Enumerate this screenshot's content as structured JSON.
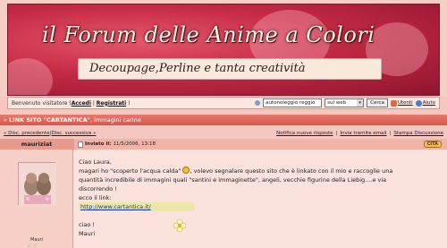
{
  "banner": {
    "title": "il Forum delle Anime a Colori",
    "subtitle": "Decoupage,Perline e tanta creatività"
  },
  "toolbar": {
    "welcome_prefix": "Benvenuto visitatore (",
    "login_label": "Accedi",
    "separator": " | ",
    "register_label": "Registrati",
    "welcome_suffix": " )",
    "search_value": "autonoleggio reggio",
    "search_scope": "sul web",
    "search_button": "Cerca",
    "users_label": "Utenti",
    "help_label": "Aiuto"
  },
  "topic": {
    "arrow": "»",
    "title": "LINK SITO \"CARTANTICA\"",
    "tail": ", immagini carine"
  },
  "nav": {
    "prev": "« Disc. precedente",
    "sep": " | ",
    "next": "Disc. successiva »",
    "notify": "Notifica nuove risposte",
    "email": "Invia tramite email",
    "print": "Stampa Discussione"
  },
  "post": {
    "author": "mauriziat",
    "sent_label": "Inviato il:",
    "sent_date": "11/5/2006, 13:18",
    "quote_button": "CITA",
    "lines": [
      "Ciao Laura,",
      "magari ho \"scoperto l'acqua calda\"",
      ", volevo segnalare questo sito che è linkato con il mio e raccoglie una",
      "quantità incredibile di immagini quali \"santini e immaginette\", angeli, vecchie figurine della Liebig....e via",
      "discorrendo !",
      "ecco il link:",
      "http://www.cartantica.it/",
      "ciao !",
      "Mauri"
    ],
    "signature_name": "Mauri"
  },
  "colors": {
    "banner_red": "#c42a44",
    "topic_bar": "#e06a5e",
    "page_bg": "#f4c8c0",
    "link": "#1a3a8a"
  }
}
